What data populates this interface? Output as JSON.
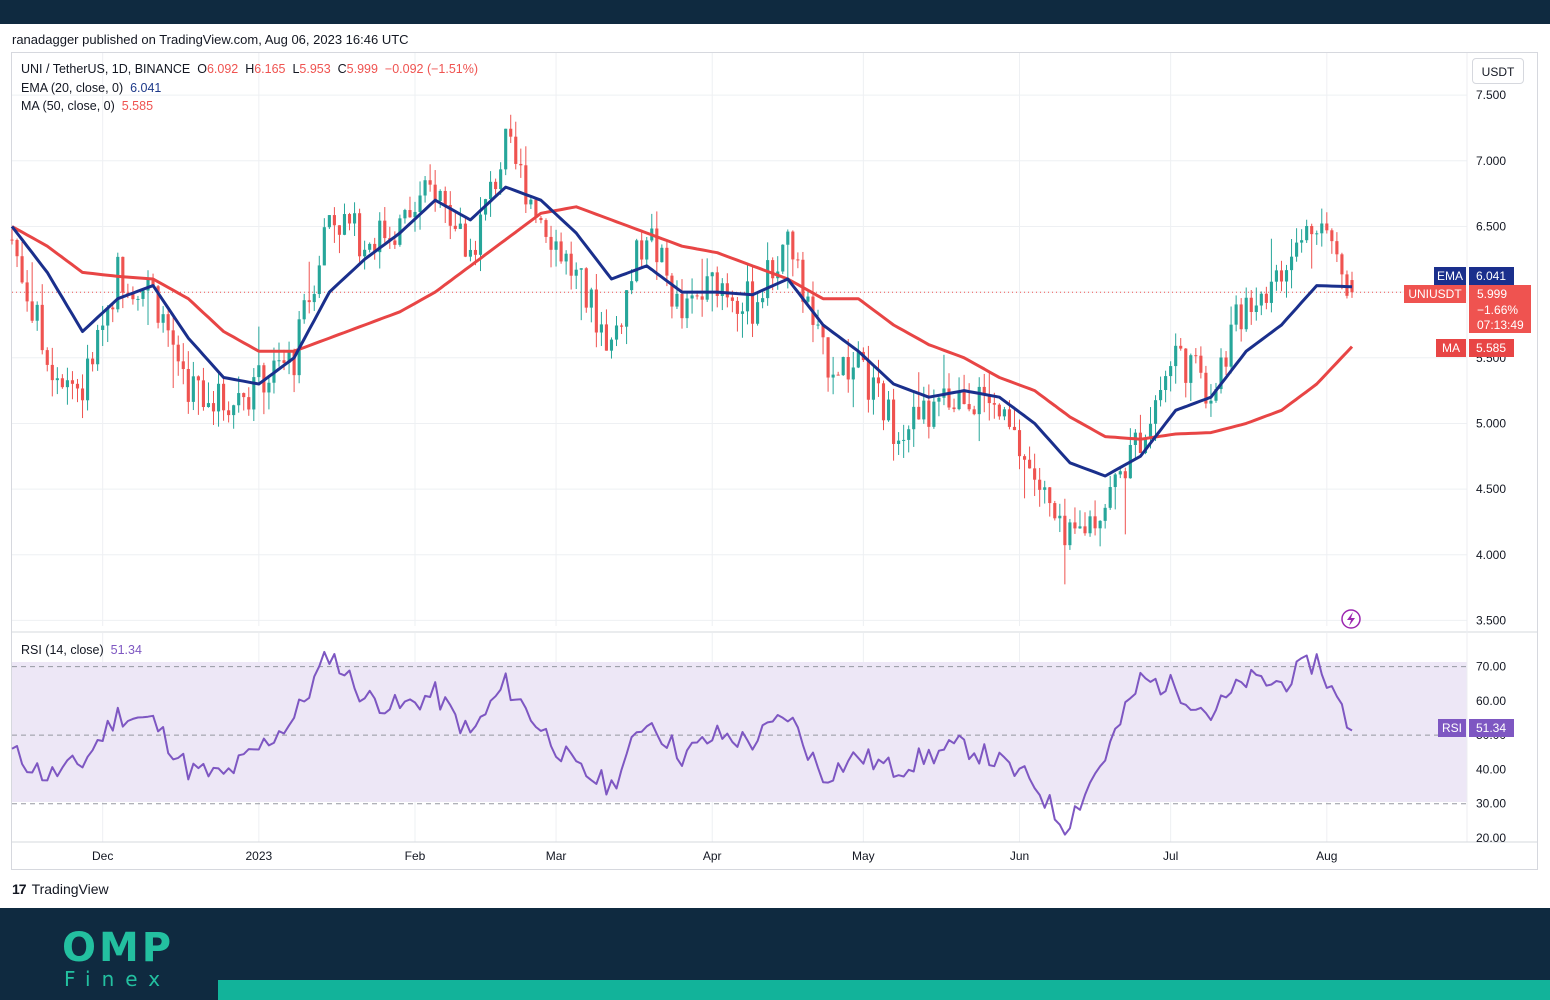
{
  "publisher": "ranadagger published on TradingView.com, Aug 06, 2023 16:46 UTC",
  "currency": "USDT",
  "header": {
    "symbol": "UNI / TetherUS, 1D, BINANCE",
    "open_label": "O",
    "open": "6.092",
    "high_label": "H",
    "high": "6.165",
    "low_label": "L",
    "low": "5.953",
    "close_label": "C",
    "close": "5.999",
    "change": "−0.092 (−1.51%)"
  },
  "indicators": {
    "ema_label": "EMA (20, close, 0)",
    "ema_value": "6.041",
    "ma_label": "MA (50, close, 0)",
    "ma_value": "5.585",
    "rsi_label": "RSI (14, close)",
    "rsi_value": "51.34"
  },
  "price_tags": {
    "ema_tag": "EMA",
    "ema_value": "6.041",
    "symbol_tag": "UNIUSDT",
    "last_price": "5.999",
    "last_change": "−1.66%",
    "countdown": "07:13:49",
    "ma_tag": "MA",
    "ma_value": "5.585",
    "rsi_tag": "RSI",
    "rsi_value": "51.34"
  },
  "brand": "TradingView",
  "footer_logo": {
    "big": "OMP",
    "small": "Finex"
  },
  "colors": {
    "up": "#26a69a",
    "down": "#ef5350",
    "ema": "#1a2f8c",
    "ma": "#e84545",
    "rsi": "#7e57c2",
    "rsi_band": "#ede7f6",
    "grid": "#eef0f3",
    "footer": "#0f2a40",
    "accent": "#12b39a"
  },
  "icons": {
    "replay": "lightning-icon"
  },
  "chart_data": {
    "type": "candlestick",
    "price_axis": {
      "ticks": [
        "7.500",
        "7.000",
        "6.500",
        "6.000",
        "5.500",
        "5.000",
        "4.500",
        "4.000",
        "3.500"
      ],
      "range": [
        3.45,
        7.6
      ]
    },
    "rsi_axis": {
      "ticks": [
        "70.00",
        "60.00",
        "50.00",
        "40.00",
        "30.00",
        "20.00"
      ],
      "range": [
        20,
        76
      ],
      "band": [
        30,
        70
      ]
    },
    "x_ticks": [
      "Dec",
      "2023",
      "Feb",
      "Mar",
      "Apr",
      "May",
      "Jun",
      "Jul",
      "Aug"
    ],
    "close_path": [
      [
        "2022-11-13",
        6.4
      ],
      [
        "2022-11-20",
        5.5
      ],
      [
        "2022-11-27",
        5.25
      ],
      [
        "2022-12-04",
        6.15
      ],
      [
        "2022-12-11",
        6.0
      ],
      [
        "2022-12-18",
        5.3
      ],
      [
        "2022-12-25",
        5.15
      ],
      [
        "2023-01-01",
        5.3
      ],
      [
        "2023-01-08",
        5.5
      ],
      [
        "2023-01-15",
        6.6
      ],
      [
        "2023-01-22",
        6.4
      ],
      [
        "2023-01-29",
        6.5
      ],
      [
        "2023-02-05",
        6.8
      ],
      [
        "2023-02-12",
        6.3
      ],
      [
        "2023-02-19",
        7.1
      ],
      [
        "2023-02-26",
        6.6
      ],
      [
        "2023-03-05",
        6.1
      ],
      [
        "2023-03-12",
        5.6
      ],
      [
        "2023-03-19",
        6.5
      ],
      [
        "2023-03-26",
        5.8
      ],
      [
        "2023-04-02",
        6.1
      ],
      [
        "2023-04-09",
        5.9
      ],
      [
        "2023-04-16",
        6.4
      ],
      [
        "2023-04-23",
        5.5
      ],
      [
        "2023-04-30",
        5.4
      ],
      [
        "2023-05-07",
        5.0
      ],
      [
        "2023-05-14",
        5.05
      ],
      [
        "2023-05-21",
        5.25
      ],
      [
        "2023-05-28",
        5.05
      ],
      [
        "2023-06-04",
        4.6
      ],
      [
        "2023-06-10",
        4.05
      ],
      [
        "2023-06-18",
        4.4
      ],
      [
        "2023-06-25",
        4.9
      ],
      [
        "2023-07-02",
        5.55
      ],
      [
        "2023-07-09",
        5.25
      ],
      [
        "2023-07-16",
        5.95
      ],
      [
        "2023-07-23",
        6.1
      ],
      [
        "2023-07-30",
        6.6
      ],
      [
        "2023-08-06",
        6.0
      ]
    ],
    "ema20": [
      [
        "2022-11-13",
        6.5
      ],
      [
        "2022-11-20",
        6.15
      ],
      [
        "2022-11-27",
        5.7
      ],
      [
        "2022-12-04",
        5.95
      ],
      [
        "2022-12-11",
        6.05
      ],
      [
        "2022-12-18",
        5.65
      ],
      [
        "2022-12-25",
        5.35
      ],
      [
        "2023-01-01",
        5.3
      ],
      [
        "2023-01-08",
        5.5
      ],
      [
        "2023-01-15",
        6.0
      ],
      [
        "2023-01-22",
        6.25
      ],
      [
        "2023-01-29",
        6.45
      ],
      [
        "2023-02-05",
        6.7
      ],
      [
        "2023-02-12",
        6.55
      ],
      [
        "2023-02-19",
        6.8
      ],
      [
        "2023-02-26",
        6.7
      ],
      [
        "2023-03-05",
        6.45
      ],
      [
        "2023-03-12",
        6.1
      ],
      [
        "2023-03-19",
        6.2
      ],
      [
        "2023-03-26",
        6.0
      ],
      [
        "2023-04-02",
        6.0
      ],
      [
        "2023-04-09",
        5.98
      ],
      [
        "2023-04-16",
        6.1
      ],
      [
        "2023-04-23",
        5.75
      ],
      [
        "2023-04-30",
        5.55
      ],
      [
        "2023-05-07",
        5.3
      ],
      [
        "2023-05-14",
        5.2
      ],
      [
        "2023-05-21",
        5.25
      ],
      [
        "2023-05-28",
        5.2
      ],
      [
        "2023-06-04",
        5.0
      ],
      [
        "2023-06-11",
        4.7
      ],
      [
        "2023-06-18",
        4.6
      ],
      [
        "2023-06-25",
        4.75
      ],
      [
        "2023-07-02",
        5.1
      ],
      [
        "2023-07-09",
        5.2
      ],
      [
        "2023-07-16",
        5.55
      ],
      [
        "2023-07-23",
        5.75
      ],
      [
        "2023-07-30",
        6.05
      ],
      [
        "2023-08-06",
        6.041
      ]
    ],
    "ma50": [
      [
        "2022-11-13",
        6.5
      ],
      [
        "2022-11-20",
        6.35
      ],
      [
        "2022-11-27",
        6.15
      ],
      [
        "2022-12-04",
        6.12
      ],
      [
        "2022-12-11",
        6.1
      ],
      [
        "2022-12-18",
        5.95
      ],
      [
        "2022-12-25",
        5.7
      ],
      [
        "2023-01-01",
        5.55
      ],
      [
        "2023-01-08",
        5.55
      ],
      [
        "2023-01-15",
        5.65
      ],
      [
        "2023-01-22",
        5.75
      ],
      [
        "2023-01-29",
        5.85
      ],
      [
        "2023-02-05",
        6.0
      ],
      [
        "2023-02-12",
        6.2
      ],
      [
        "2023-02-19",
        6.4
      ],
      [
        "2023-02-26",
        6.6
      ],
      [
        "2023-03-05",
        6.65
      ],
      [
        "2023-03-12",
        6.55
      ],
      [
        "2023-03-19",
        6.45
      ],
      [
        "2023-03-26",
        6.35
      ],
      [
        "2023-04-02",
        6.3
      ],
      [
        "2023-04-09",
        6.2
      ],
      [
        "2023-04-16",
        6.1
      ],
      [
        "2023-04-23",
        5.95
      ],
      [
        "2023-04-30",
        5.95
      ],
      [
        "2023-05-07",
        5.75
      ],
      [
        "2023-05-14",
        5.6
      ],
      [
        "2023-05-21",
        5.5
      ],
      [
        "2023-05-28",
        5.35
      ],
      [
        "2023-06-04",
        5.25
      ],
      [
        "2023-06-11",
        5.05
      ],
      [
        "2023-06-18",
        4.9
      ],
      [
        "2023-06-25",
        4.88
      ],
      [
        "2023-07-02",
        4.92
      ],
      [
        "2023-07-09",
        4.93
      ],
      [
        "2023-07-16",
        5.0
      ],
      [
        "2023-07-23",
        5.1
      ],
      [
        "2023-07-30",
        5.3
      ],
      [
        "2023-08-06",
        5.585
      ]
    ],
    "rsi": [
      [
        "2022-11-13",
        45
      ],
      [
        "2022-11-20",
        38
      ],
      [
        "2022-11-27",
        42
      ],
      [
        "2022-12-04",
        56
      ],
      [
        "2022-12-11",
        54
      ],
      [
        "2022-12-18",
        40
      ],
      [
        "2022-12-25",
        38
      ],
      [
        "2023-01-01",
        46
      ],
      [
        "2023-01-08",
        55
      ],
      [
        "2023-01-15",
        74
      ],
      [
        "2023-01-22",
        61
      ],
      [
        "2023-01-29",
        58
      ],
      [
        "2023-02-05",
        62
      ],
      [
        "2023-02-12",
        50
      ],
      [
        "2023-02-19",
        65
      ],
      [
        "2023-02-26",
        52
      ],
      [
        "2023-03-05",
        40
      ],
      [
        "2023-03-12",
        35
      ],
      [
        "2023-03-19",
        55
      ],
      [
        "2023-03-26",
        44
      ],
      [
        "2023-04-02",
        50
      ],
      [
        "2023-04-09",
        48
      ],
      [
        "2023-04-16",
        56
      ],
      [
        "2023-04-23",
        38
      ],
      [
        "2023-04-30",
        44
      ],
      [
        "2023-05-07",
        40
      ],
      [
        "2023-05-14",
        44
      ],
      [
        "2023-05-21",
        47
      ],
      [
        "2023-05-28",
        42
      ],
      [
        "2023-06-04",
        36
      ],
      [
        "2023-06-10",
        23
      ],
      [
        "2023-06-18",
        44
      ],
      [
        "2023-06-25",
        66
      ],
      [
        "2023-07-02",
        64
      ],
      [
        "2023-07-09",
        56
      ],
      [
        "2023-07-16",
        66
      ],
      [
        "2023-07-23",
        65
      ],
      [
        "2023-07-30",
        72
      ],
      [
        "2023-08-06",
        51.34
      ]
    ]
  }
}
